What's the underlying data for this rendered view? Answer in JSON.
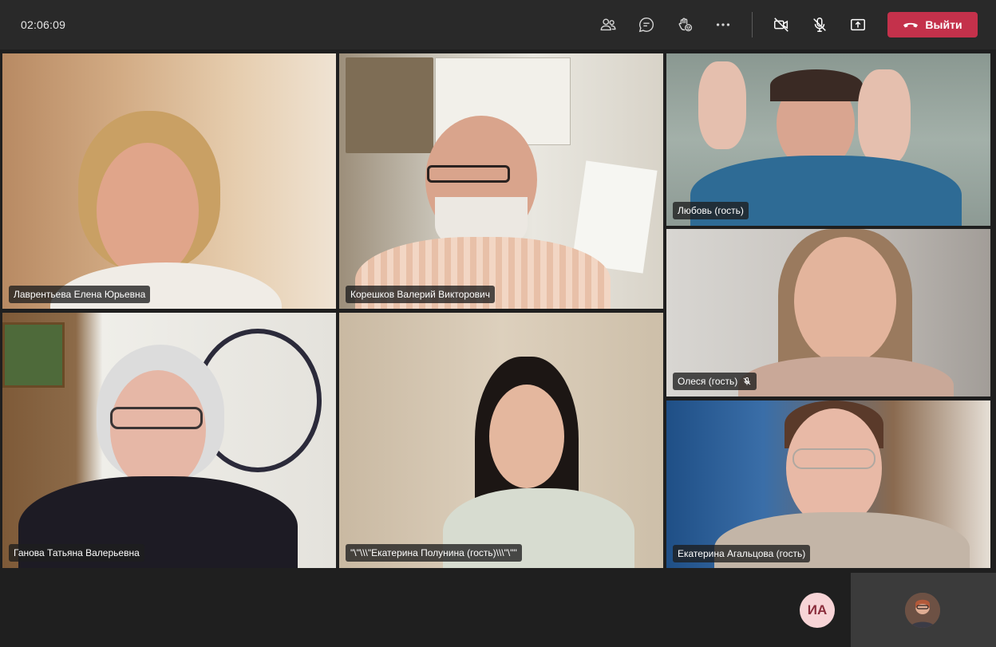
{
  "meeting": {
    "timer": "02:06:09",
    "leave_label": "Выйти"
  },
  "toolbar": {
    "icons": [
      "participants-icon",
      "chat-icon",
      "reactions-icon",
      "more-options-icon",
      "camera-off-icon",
      "mic-off-icon",
      "share-screen-icon",
      "phone-hangup-icon"
    ]
  },
  "participants": [
    {
      "name": "Лаврентьева Елена Юрьевна",
      "muted": false
    },
    {
      "name": "Корешков Валерий Викторович",
      "muted": false
    },
    {
      "name": "Любовь (гость)",
      "muted": false
    },
    {
      "name": "Олеся (гость)",
      "muted": true
    },
    {
      "name": "Ганова Татьяна Валерьевна",
      "muted": false
    },
    {
      "name": "\"\\\"\\\\\\\"Екатерина Полунина (гость)\\\\\\\"\\\"\"",
      "muted": false
    },
    {
      "name": "Екатерина Агальцова (гость)",
      "muted": false
    }
  ],
  "bottom": {
    "initials": "ИА"
  },
  "colors": {
    "leave": "#c4314b",
    "topbar": "#292929",
    "stage": "#1f1f1f",
    "initials_bg": "#f7d4d6"
  }
}
